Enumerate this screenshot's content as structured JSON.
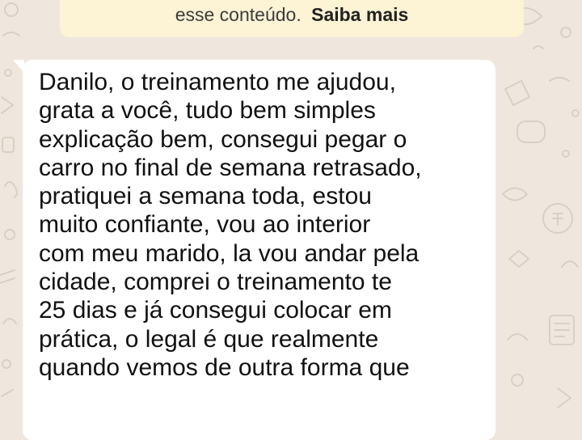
{
  "system_notice": {
    "text": "esse conteúdo.",
    "link": "Saiba mais"
  },
  "message": {
    "lines": [
      "Danilo, o treinamento me ajudou,",
      "grata a você, tudo bem simples",
      "explicação bem, consegui pegar o",
      "carro no final de semana retrasado,",
      "pratiquei a semana toda, estou",
      "muito confiante, vou ao interior",
      "com meu marido, la vou andar pela",
      "cidade, comprei o treinamento te",
      "25 dias e já consegui colocar em",
      "prática, o legal é que realmente",
      "quando vemos de outra forma que"
    ]
  },
  "colors": {
    "wallpaper": "#efe7de",
    "notice_background": "#fdf3d5",
    "bubble_background": "#ffffff"
  },
  "icons": [
    "doodle-pattern"
  ]
}
